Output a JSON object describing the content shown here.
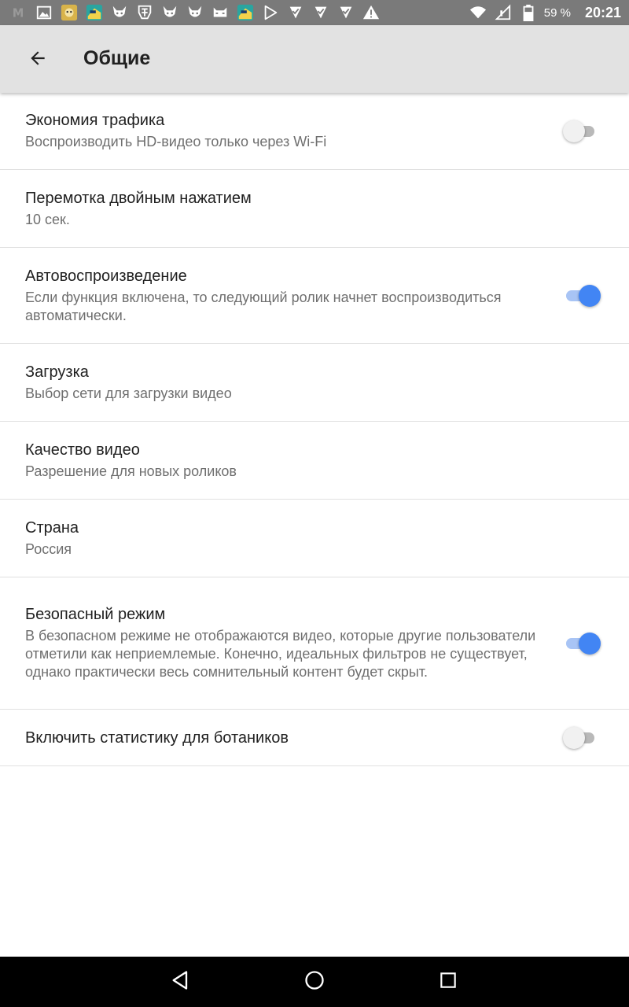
{
  "status_bar": {
    "notification_icons": [
      "m-icon",
      "image-icon",
      "app-icon",
      "game-icon",
      "pokemon-icon",
      "transformers-icon",
      "pokemon-icon",
      "pokemon-icon",
      "cat-icon",
      "game-icon",
      "play-store-icon",
      "check-icon",
      "check-icon",
      "check-icon",
      "warning-icon"
    ],
    "battery": "59 %",
    "time": "20:21"
  },
  "app_bar": {
    "title": "Общие"
  },
  "settings": [
    {
      "title": "Экономия трафика",
      "desc": "Воспроизводить HD-видео только через Wi-Fi",
      "toggle": "off"
    },
    {
      "title": "Перемотка двойным нажатием",
      "desc": "10 сек.",
      "toggle": null
    },
    {
      "title": "Автовоспроизведение",
      "desc": "Если функция включена, то следующий ролик начнет воспроизводиться автоматически.",
      "toggle": "on"
    },
    {
      "title": "Загрузка",
      "desc": "Выбор сети для загрузки видео",
      "toggle": null
    },
    {
      "title": "Качество видео",
      "desc": "Разрешение для новых роликов",
      "toggle": null
    },
    {
      "title": "Страна",
      "desc": "Россия",
      "toggle": null
    },
    {
      "title": "Безопасный режим",
      "desc": "В безопасном режиме не отображаются видео, которые другие пользователи отметили как неприемлемые. Конечно, идеальных фильтров не существует, однако практически весь сомнительный контент будет скрыт.",
      "toggle": "on"
    },
    {
      "title": "Включить статистику для ботаников",
      "desc": "",
      "toggle": "off"
    }
  ],
  "colors": {
    "accent": "#4285f4",
    "app_bar": "#e2e2e2",
    "status_bar": "#7a7a7a"
  }
}
